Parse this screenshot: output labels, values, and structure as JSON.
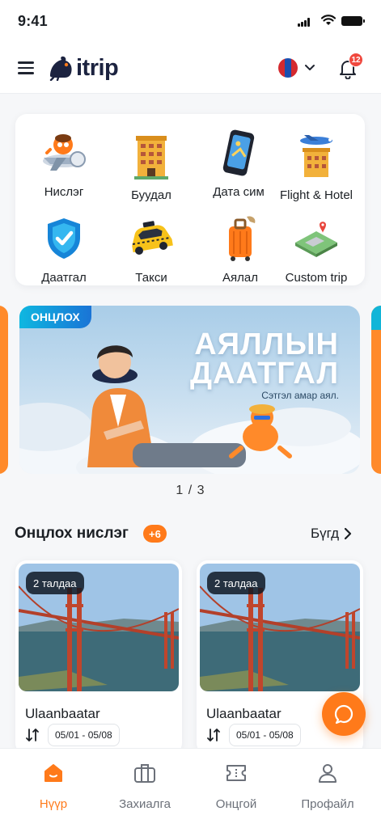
{
  "status_bar": {
    "time": "9:41"
  },
  "header": {
    "logo_text": "itrip",
    "notification_count": "12",
    "language": "mongolian-flag"
  },
  "services": [
    {
      "label": "Нислэг",
      "icon": "airplane-icon"
    },
    {
      "label": "Буудал",
      "icon": "hotel-building-icon"
    },
    {
      "label": "Дата сим",
      "icon": "phone-sim-icon"
    },
    {
      "label": "Flight & Hotel",
      "icon": "flight-hotel-icon"
    },
    {
      "label": "Даатгал",
      "icon": "shield-check-icon"
    },
    {
      "label": "Такси",
      "icon": "taxi-icon"
    },
    {
      "label": "Аялал",
      "icon": "suitcase-icon"
    },
    {
      "label": "Custom trip",
      "icon": "map-pin-icon"
    }
  ],
  "banner": {
    "tag": "ОНЦЛОХ",
    "title_line1": "АЯЛЛЫН",
    "title_line2": "ДААТГАЛ",
    "subtitle": "Сэтгэл амар аял.",
    "pager": "1 / 3"
  },
  "featured": {
    "title": "Онцлох нислэг",
    "count": "+6",
    "see_all": "Бүгд",
    "cards": [
      {
        "days": "2 талдаа",
        "city": "Ulaanbaatar",
        "dates": "05/01 - 05/08"
      },
      {
        "days": "2 талдаа",
        "city": "Ulaanbaatar",
        "dates": "05/01 - 05/08"
      }
    ]
  },
  "tabbar": {
    "tabs": [
      {
        "label": "Нүүр",
        "icon": "home-icon",
        "active": true
      },
      {
        "label": "Захиалга",
        "icon": "briefcase-icon",
        "active": false
      },
      {
        "label": "Онцгой",
        "icon": "ticket-icon",
        "active": false
      },
      {
        "label": "Профайл",
        "icon": "user-icon",
        "active": false
      }
    ]
  },
  "colors": {
    "accent": "#ff7a1a",
    "tag_blue": "#1a74d6",
    "notification": "#f0483e"
  }
}
